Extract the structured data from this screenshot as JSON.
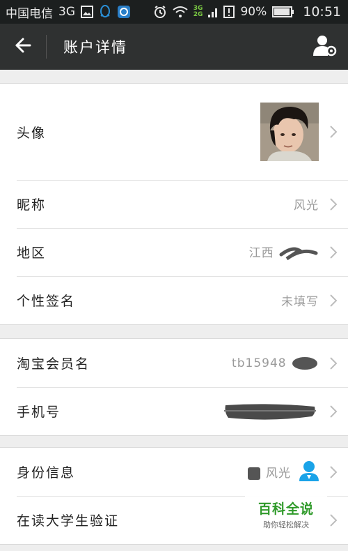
{
  "status_bar": {
    "carrier": "中国电信",
    "network": "3G",
    "small_network_top": "3G",
    "small_network_bottom": "2G",
    "battery_percent": "90%",
    "time": "10:51"
  },
  "header": {
    "title": "账户详情",
    "back_icon": "back-arrow-icon",
    "profile_icon": "user-settings-icon"
  },
  "groups": [
    {
      "rows": [
        {
          "label": "头像",
          "value": ""
        },
        {
          "label": "昵称",
          "value": "风光"
        },
        {
          "label": "地区",
          "value": "江西"
        },
        {
          "label": "个性签名",
          "value": "未填写"
        }
      ]
    },
    {
      "rows": [
        {
          "label": "淘宝会员名",
          "value": "tb15948"
        },
        {
          "label": "手机号",
          "value": ""
        }
      ]
    },
    {
      "rows": [
        {
          "label": "身份信息",
          "value": "风光"
        },
        {
          "label": "在读大学生验证",
          "value": ""
        }
      ]
    }
  ],
  "watermark": {
    "main": "百科全说",
    "sub": "助你轻松解决"
  },
  "colors": {
    "header_bg": "#2f3131",
    "status_bg": "#1c1f1f",
    "page_bg": "#eeeeee",
    "id_icon": "#1aa3e8",
    "watermark_green": "#2f9a2a"
  }
}
